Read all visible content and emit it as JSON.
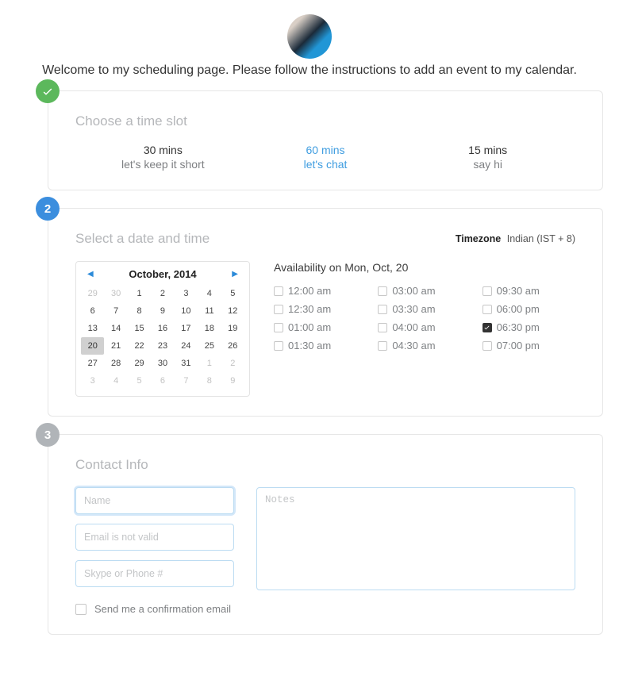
{
  "welcome_text": "Welcome to my scheduling page. Please follow the instructions to add an event to my calendar.",
  "step1": {
    "title": "Choose a time slot",
    "slots": [
      {
        "duration": "30 mins",
        "sub": "let's keep it short",
        "active": false
      },
      {
        "duration": "60 mins",
        "sub": "let's chat",
        "active": true
      },
      {
        "duration": "15 mins",
        "sub": "say hi",
        "active": false
      }
    ]
  },
  "step2": {
    "title": "Select a date and time",
    "timezone_label": "Timezone",
    "timezone_value": "Indian (IST + 8)",
    "month_label": "October, 2014",
    "calendar_rows": [
      [
        {
          "d": "29",
          "muted": true
        },
        {
          "d": "30",
          "muted": true
        },
        {
          "d": "1"
        },
        {
          "d": "2"
        },
        {
          "d": "3"
        },
        {
          "d": "4"
        },
        {
          "d": "5"
        }
      ],
      [
        {
          "d": "6"
        },
        {
          "d": "7"
        },
        {
          "d": "8"
        },
        {
          "d": "9"
        },
        {
          "d": "10"
        },
        {
          "d": "11"
        },
        {
          "d": "12"
        }
      ],
      [
        {
          "d": "13"
        },
        {
          "d": "14"
        },
        {
          "d": "15"
        },
        {
          "d": "16"
        },
        {
          "d": "17"
        },
        {
          "d": "18"
        },
        {
          "d": "19"
        }
      ],
      [
        {
          "d": "20",
          "selected": true
        },
        {
          "d": "21"
        },
        {
          "d": "22"
        },
        {
          "d": "23"
        },
        {
          "d": "24"
        },
        {
          "d": "25"
        },
        {
          "d": "26"
        }
      ],
      [
        {
          "d": "27"
        },
        {
          "d": "28"
        },
        {
          "d": "29"
        },
        {
          "d": "30"
        },
        {
          "d": "31"
        },
        {
          "d": "1",
          "muted": true
        },
        {
          "d": "2",
          "muted": true
        }
      ],
      [
        {
          "d": "3",
          "muted": true
        },
        {
          "d": "4",
          "muted": true
        },
        {
          "d": "5",
          "muted": true
        },
        {
          "d": "6",
          "muted": true
        },
        {
          "d": "7",
          "muted": true
        },
        {
          "d": "8",
          "muted": true
        },
        {
          "d": "9",
          "muted": true
        }
      ]
    ],
    "avail_title": "Availability on Mon, Oct, 20",
    "times": [
      {
        "t": "12:00 am"
      },
      {
        "t": "03:00 am"
      },
      {
        "t": "09:30 am"
      },
      {
        "t": "12:30 am"
      },
      {
        "t": "03:30 am"
      },
      {
        "t": "06:00 pm"
      },
      {
        "t": "01:00 am"
      },
      {
        "t": "04:00 am"
      },
      {
        "t": "06:30 pm",
        "checked": true
      },
      {
        "t": "01:30 am"
      },
      {
        "t": "04:30 am"
      },
      {
        "t": "07:00 pm"
      }
    ]
  },
  "step3": {
    "badge": "3",
    "title": "Contact Info",
    "name_ph": "Name",
    "email_ph": "Email is not valid",
    "phone_ph": "Skype or Phone #",
    "notes_ph": "Notes",
    "confirm_label": "Send me a confirmation email"
  },
  "badge2": "2"
}
